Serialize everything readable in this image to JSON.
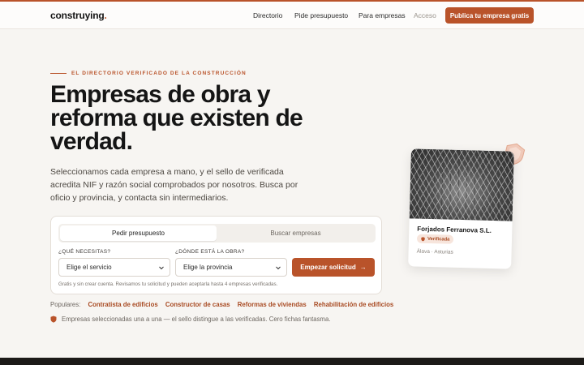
{
  "nav": {
    "logo_text": "construying",
    "logo_dot": ".",
    "links": [
      "Directorio",
      "Pide presupuesto",
      "Para empresas",
      "Acceso"
    ],
    "cta": "Publica tu empresa gratis"
  },
  "hero": {
    "eyebrow": "EL DIRECTORIO VERIFICADO DE LA CONSTRUCCIÓN",
    "title": "Empresas de obra y reforma que existen de verdad.",
    "lead": "Seleccionamos cada empresa a mano, y el sello de verificada acredita NIF y razón social comprobados por nosotros. Busca por oficio y provincia, y contacta sin intermediarios."
  },
  "form": {
    "tabs": [
      "Pedir presupuesto",
      "Buscar empresas"
    ],
    "service_label": "¿QUÉ NECESITAS?",
    "service_value": "Elige el servicio",
    "location_label": "¿DÓNDE ESTÁ LA OBRA?",
    "location_value": "Elige la provincia",
    "submit": "Empezar solicitud",
    "submit_arrow": "→",
    "note": "Gratis y sin crear cuenta. Revisamos tu solicitud y pueden aceptarla hasta 4 empresas verificadas."
  },
  "popular": {
    "label": "Populares:",
    "links": [
      "Contratista de edificios",
      "Constructor de casas",
      "Reformas de viviendas",
      "Rehabilitación de edificios"
    ]
  },
  "trust": "Empresas seleccionadas una a una — el sello distingue a las verificadas. Cero fichas fantasma.",
  "company": {
    "name": "Forjados Ferranova S.L.",
    "badge": "Verificada",
    "location": "Álava · Asturias"
  },
  "colors": {
    "accent": "#b9532a",
    "background": "#f7f5f2",
    "dark": "#1c1a18"
  }
}
